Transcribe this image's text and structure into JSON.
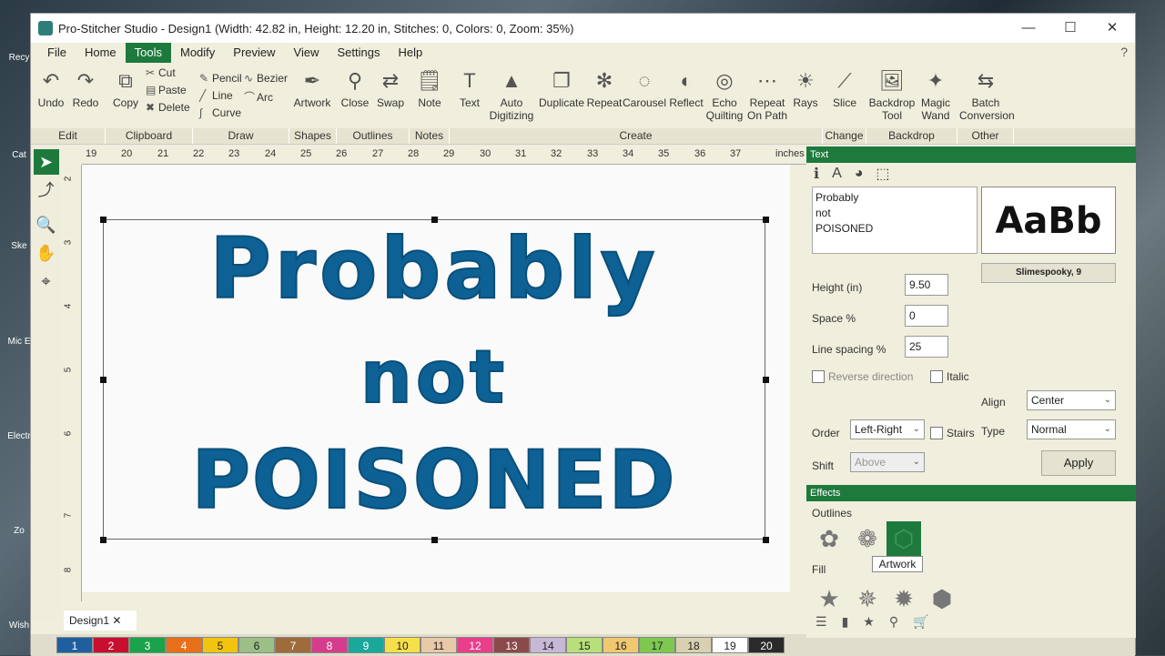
{
  "desktop_icons": [
    "Recy",
    "Cat",
    "Ske",
    "Mic E",
    "Electr",
    "Zo",
    "Wish"
  ],
  "window": {
    "title": "Pro-Stitcher Studio - Design1 (Width: 42.82 in, Height: 12.20 in, Stitches: 0, Colors: 0, Zoom: 35%)",
    "minimize": "—",
    "maximize": "☐",
    "close": "✕"
  },
  "menu": [
    "File",
    "Home",
    "Tools",
    "Modify",
    "Preview",
    "View",
    "Settings",
    "Help"
  ],
  "menu_active": "Tools",
  "help_icon": "?",
  "ribbon": {
    "undo": "Undo",
    "redo": "Redo",
    "copy": "Copy",
    "cut": "Cut",
    "paste": "Paste",
    "delete": "Delete",
    "pencil": "Pencil",
    "line": "Line",
    "curve": "Curve",
    "bezier": "Bezier",
    "arc": "Arc",
    "artwork": "Artwork",
    "close": "Close",
    "swap": "Swap",
    "note": "Note",
    "text": "Text",
    "auto_digitizing": "Auto Digitizing",
    "duplicate": "Duplicate",
    "repeat": "Repeat",
    "carousel": "Carousel",
    "reflect": "Reflect",
    "echo_quilting": "Echo Quilting",
    "repeat_on_path": "Repeat On Path",
    "rays": "Rays",
    "slice": "Slice",
    "backdrop_tool": "Backdrop Tool",
    "magic_wand": "Magic Wand",
    "batch_conversion": "Batch Conversion"
  },
  "groups": [
    "Edit",
    "Clipboard",
    "Draw",
    "Shapes",
    "Outlines",
    "Notes",
    "Create",
    "Change",
    "Backdrop",
    "Other"
  ],
  "ruler": {
    "h": [
      "19",
      "20",
      "21",
      "22",
      "23",
      "24",
      "25",
      "26",
      "27",
      "28",
      "29",
      "30",
      "31",
      "32",
      "33",
      "34",
      "35",
      "36",
      "37"
    ],
    "unit": "inches",
    "v": [
      "2",
      "3",
      "4",
      "5",
      "6",
      "7",
      "8"
    ]
  },
  "design_text": [
    "Probably",
    "not",
    "POISONED"
  ],
  "doc_tab": "Design1",
  "palette": [
    {
      "n": "1",
      "c": "#1f5fa0"
    },
    {
      "n": "2",
      "c": "#c8102e"
    },
    {
      "n": "3",
      "c": "#1aa34a"
    },
    {
      "n": "4",
      "c": "#e8701a"
    },
    {
      "n": "5",
      "c": "#f2c40f"
    },
    {
      "n": "6",
      "c": "#9bbf86"
    },
    {
      "n": "7",
      "c": "#9e6b3b"
    },
    {
      "n": "8",
      "c": "#d63c8c"
    },
    {
      "n": "9",
      "c": "#1aa89c"
    },
    {
      "n": "10",
      "c": "#f5e04a"
    },
    {
      "n": "11",
      "c": "#e8c9a8"
    },
    {
      "n": "12",
      "c": "#e83e8c"
    },
    {
      "n": "13",
      "c": "#8a4a4a"
    },
    {
      "n": "14",
      "c": "#c7b8d8"
    },
    {
      "n": "15",
      "c": "#b8e07a"
    },
    {
      "n": "16",
      "c": "#f0c870"
    },
    {
      "n": "17",
      "c": "#7ec850"
    },
    {
      "n": "18",
      "c": "#d8d0b0"
    },
    {
      "n": "19",
      "c": "#ffffff"
    },
    {
      "n": "20",
      "c": "#2a2a2a"
    }
  ],
  "panel": {
    "text_header": "Text",
    "text_lines": [
      "Probably",
      "not",
      "POISONED"
    ],
    "preview": "AaBb",
    "font_name": "Slimespooky, 9",
    "height_label": "Height (in)",
    "height_value": "9.50",
    "space_label": "Space %",
    "space_value": "0",
    "linesp_label": "Line spacing %",
    "linesp_value": "25",
    "reverse_label": "Reverse direction",
    "italic_label": "Italic",
    "align_label": "Align",
    "align_value": "Center",
    "order_label": "Order",
    "order_value": "Left-Right",
    "stairs_label": "Stairs",
    "type_label": "Type",
    "type_value": "Normal",
    "shift_label": "Shift",
    "shift_value": "Above",
    "apply": "Apply",
    "effects_header": "Effects",
    "outlines_label": "Outlines",
    "fill_label": "Fill",
    "tooltip": "Artwork"
  }
}
